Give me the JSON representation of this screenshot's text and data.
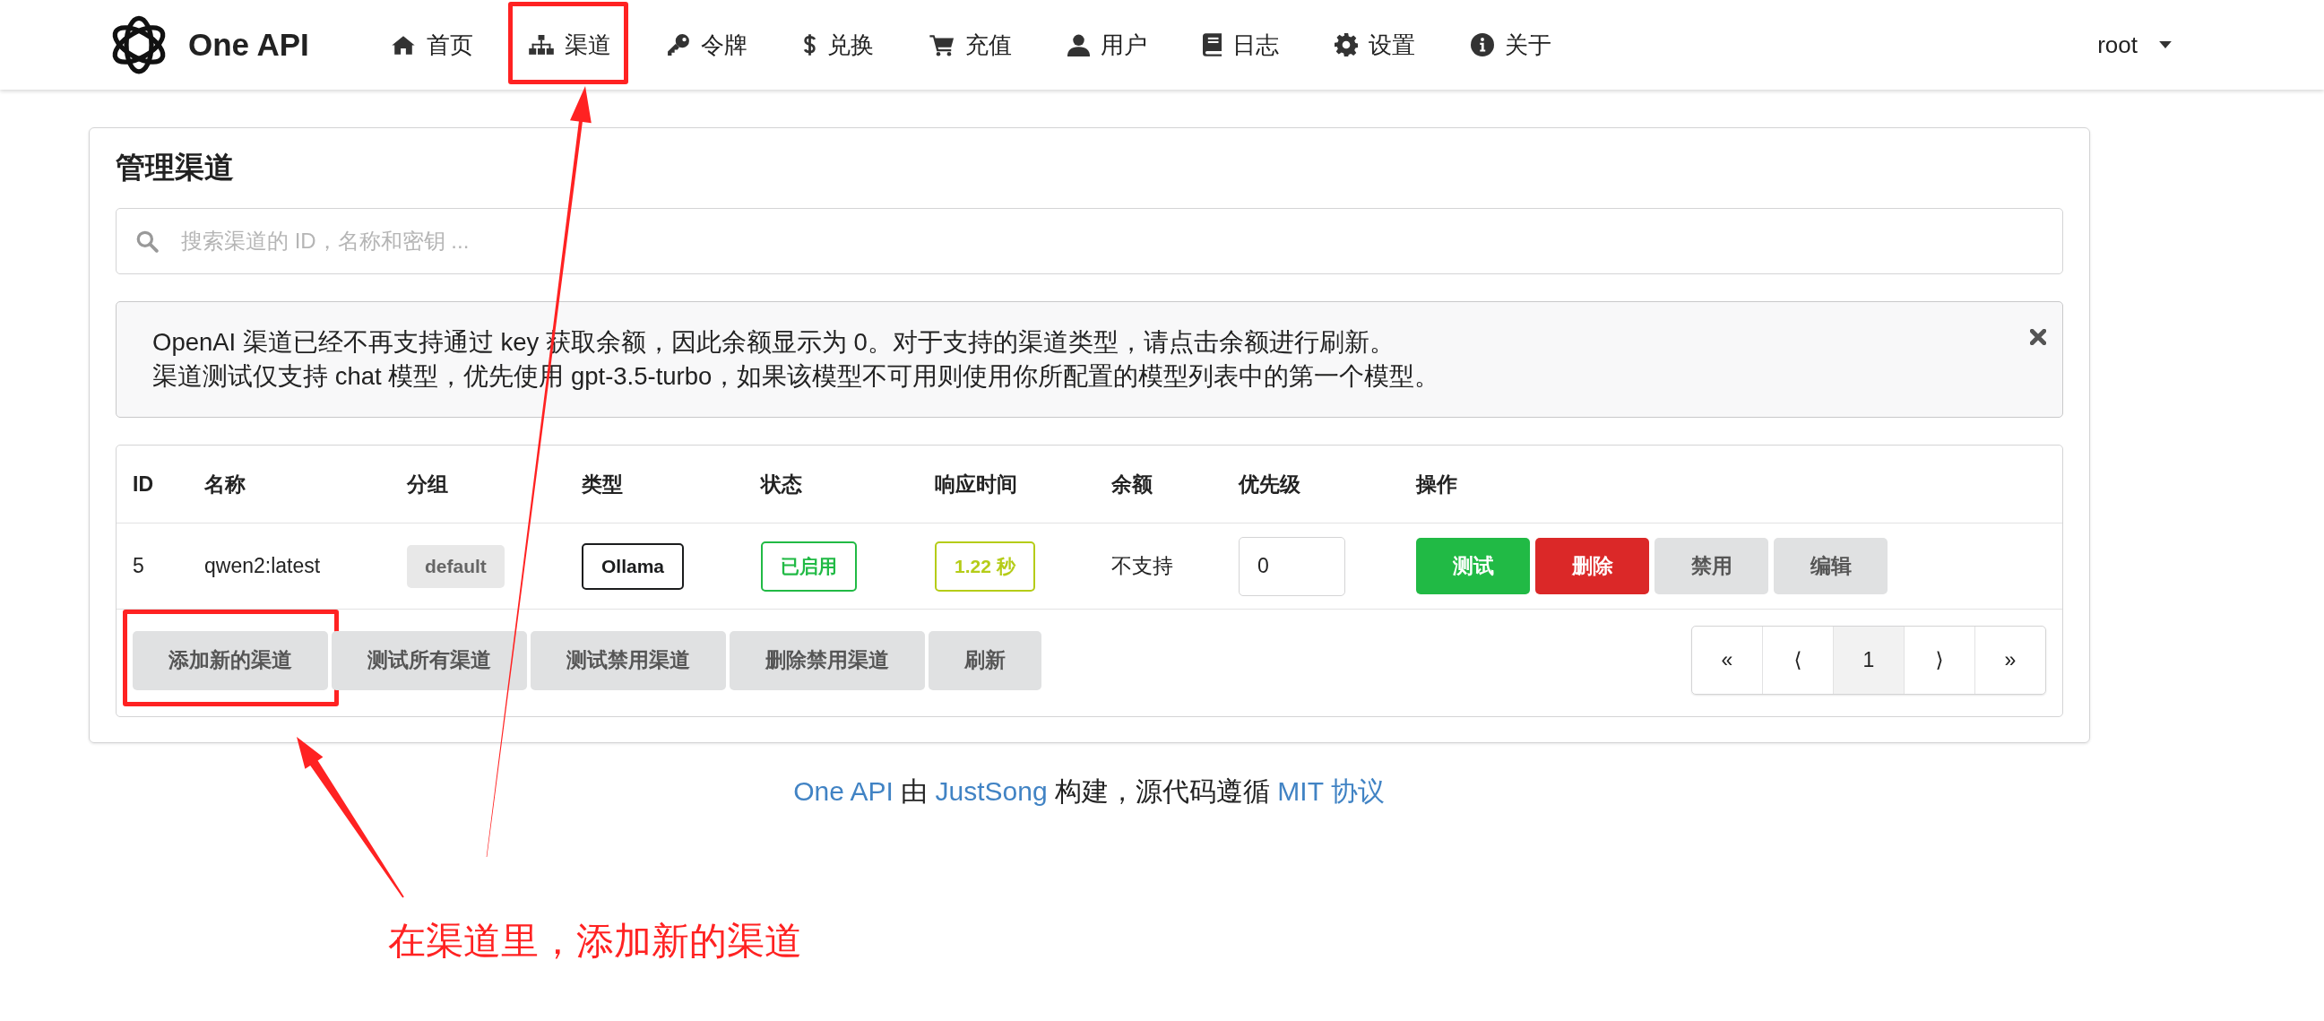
{
  "brand": {
    "name": "One API"
  },
  "nav": [
    {
      "label": "首页",
      "highlighted": false
    },
    {
      "label": "渠道",
      "highlighted": true
    },
    {
      "label": "令牌",
      "highlighted": false
    },
    {
      "label": "兑换",
      "highlighted": false
    },
    {
      "label": "充值",
      "highlighted": false
    },
    {
      "label": "用户",
      "highlighted": false
    },
    {
      "label": "日志",
      "highlighted": false
    },
    {
      "label": "设置",
      "highlighted": false
    },
    {
      "label": "关于",
      "highlighted": false
    }
  ],
  "user_menu": {
    "label": "root"
  },
  "page": {
    "title": "管理渠道",
    "search": {
      "placeholder": "搜索渠道的 ID，名称和密钥 ..."
    },
    "message": {
      "lines": [
        "OpenAI 渠道已经不再支持通过 key 获取余额，因此余额显示为 0。对于支持的渠道类型，请点击余额进行刷新。",
        "渠道测试仅支持 chat 模型，优先使用 gpt-3.5-turbo，如果该模型不可用则使用你所配置的模型列表中的第一个模型。"
      ]
    },
    "table": {
      "columns": [
        "ID",
        "名称",
        "分组",
        "类型",
        "状态",
        "响应时间",
        "余额",
        "优先级",
        "操作"
      ],
      "rows": [
        {
          "id": "5",
          "name": "qwen2:latest",
          "group": "default",
          "type": "Ollama",
          "status": {
            "label": "已启用",
            "color": "#21ba45"
          },
          "response_time": {
            "label": "1.22 秒",
            "color": "#b5cc18"
          },
          "balance": "不支持",
          "priority": "0",
          "actions": [
            {
              "label": "测试",
              "kind": "positive"
            },
            {
              "label": "删除",
              "kind": "negative"
            },
            {
              "label": "禁用",
              "kind": "plain"
            },
            {
              "label": "编辑",
              "kind": "plain"
            }
          ]
        }
      ],
      "footer_buttons": [
        {
          "label": "添加新的渠道",
          "highlighted": true
        },
        {
          "label": "测试所有渠道",
          "highlighted": false
        },
        {
          "label": "测试禁用渠道",
          "highlighted": false
        },
        {
          "label": "删除禁用渠道",
          "highlighted": false
        },
        {
          "label": "刷新",
          "highlighted": false
        }
      ],
      "pagination": [
        {
          "label": "«",
          "selected": false
        },
        {
          "label": "⟨",
          "selected": false
        },
        {
          "label": "1",
          "selected": true
        },
        {
          "label": "⟩",
          "selected": false
        },
        {
          "label": "»",
          "selected": false
        }
      ]
    }
  },
  "footer": {
    "parts": [
      {
        "text": "One API",
        "link": true
      },
      {
        "text": " 由 ",
        "link": false
      },
      {
        "text": "JustSong",
        "link": true
      },
      {
        "text": " 构建，源代码遵循 ",
        "link": false
      },
      {
        "text": "MIT 协议",
        "link": true
      }
    ]
  },
  "annotation": {
    "text": "在渠道里，添加新的渠道"
  }
}
